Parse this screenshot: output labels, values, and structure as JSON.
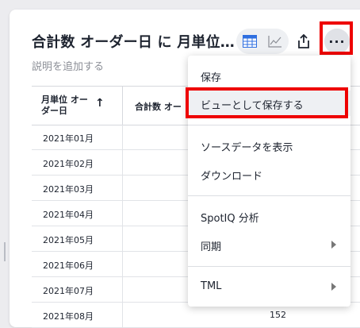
{
  "header": {
    "title": "合計数 オーダー日 に 月単位…",
    "subtitle": "説明を追加する"
  },
  "toolbar": {
    "table_icon": "table-icon",
    "chart_icon": "line-chart-icon",
    "share_icon": "share-icon",
    "more_label": "···"
  },
  "table": {
    "col1_header": "月単位 オーダー日",
    "sort_arrow": "↑",
    "col2_header": "合計数 オー",
    "rows": [
      {
        "month": "2021年01月",
        "value": ""
      },
      {
        "month": "2021年02月",
        "value": ""
      },
      {
        "month": "2021年03月",
        "value": ""
      },
      {
        "month": "2021年04月",
        "value": ""
      },
      {
        "month": "2021年05月",
        "value": ""
      },
      {
        "month": "2021年06月",
        "value": ""
      },
      {
        "month": "2021年07月",
        "value": ""
      },
      {
        "month": "2021年08月",
        "value": "152"
      }
    ]
  },
  "menu": {
    "items": [
      {
        "label": "保存"
      },
      {
        "label": "ビューとして保存する"
      },
      {
        "label": "ソースデータを表示"
      },
      {
        "label": "ダウンロード"
      },
      {
        "label": "SpotIQ 分析"
      },
      {
        "label": "同期"
      },
      {
        "label": "TML"
      }
    ]
  },
  "colors": {
    "highlight": "#e00000",
    "primary_icon": "#2f6fe0"
  }
}
